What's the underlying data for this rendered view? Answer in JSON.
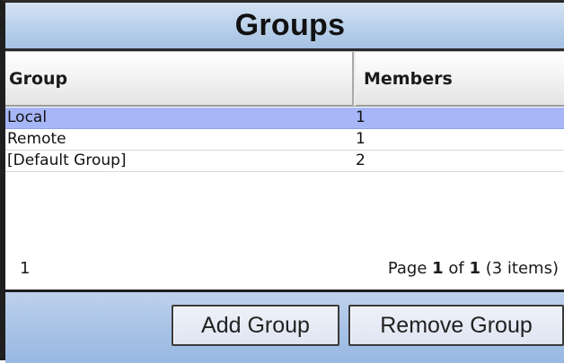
{
  "panel": {
    "title": "Groups"
  },
  "table": {
    "columns": [
      {
        "label": "Group"
      },
      {
        "label": "Members"
      }
    ],
    "rows": [
      {
        "group": "Local",
        "members": "1",
        "selected": true
      },
      {
        "group": "Remote",
        "members": "1",
        "selected": false
      },
      {
        "group": "[Default Group]",
        "members": "2",
        "selected": false
      }
    ]
  },
  "pager": {
    "current_page_link": "1",
    "summary_prefix": "Page ",
    "page": "1",
    "of_text": " of ",
    "total_pages": "1",
    "items_text": " (3 items)"
  },
  "footer": {
    "add_button": "Add Group",
    "remove_button": "Remove Group"
  },
  "colors": {
    "selected_row": "#a7b6f7",
    "title_bar": "#b9d0ea",
    "footer_bar": "#a9c3e6"
  }
}
